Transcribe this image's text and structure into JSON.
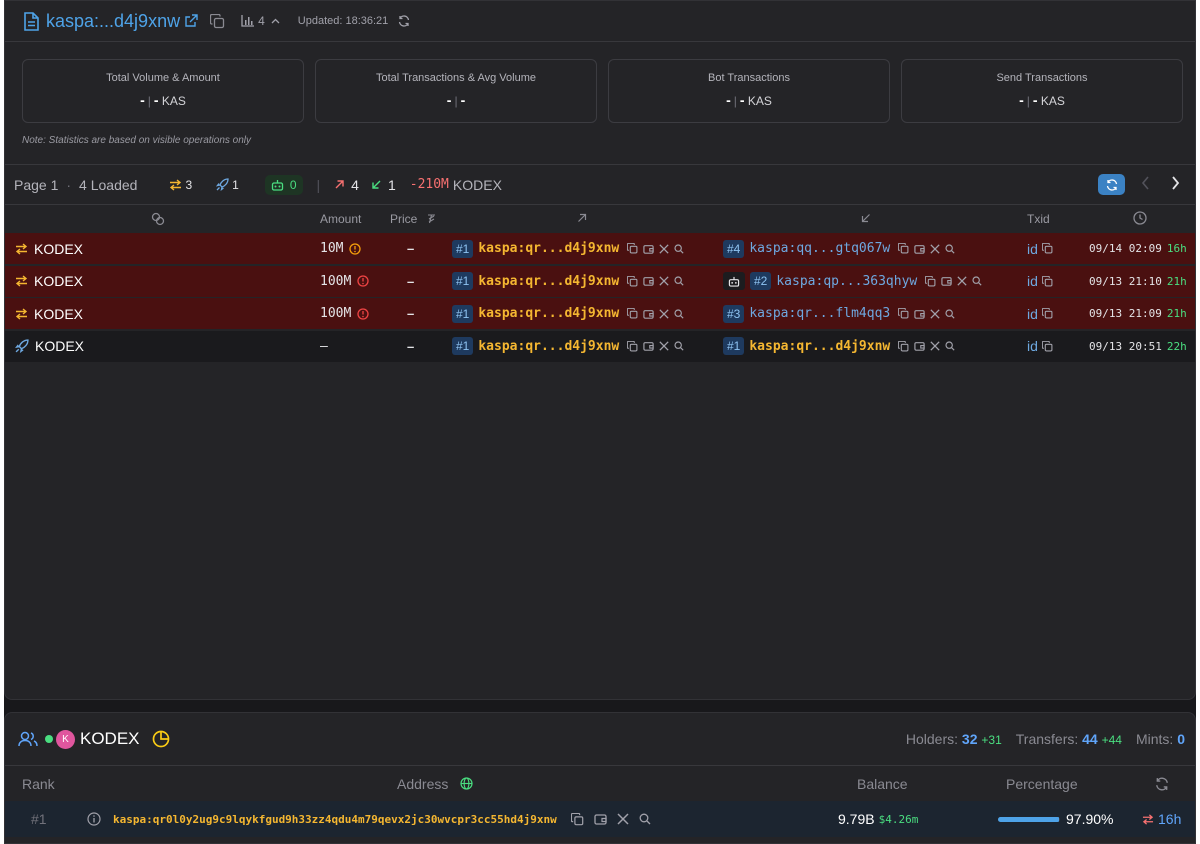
{
  "header": {
    "title": "kaspa:...d4j9xnw",
    "holders_count": "4",
    "updated": "Updated: 18:36:21"
  },
  "cards": [
    {
      "title": "Total Volume & Amount",
      "v1": "-",
      "sep": "|",
      "v2": "-",
      "unit": "KAS"
    },
    {
      "title": "Total Transactions & Avg Volume",
      "v1": "-",
      "sep": "|",
      "v2": "-",
      "unit": ""
    },
    {
      "title": "Bot Transactions",
      "v1": "-",
      "sep": "|",
      "v2": "-",
      "unit": "KAS"
    },
    {
      "title": "Send Transactions",
      "v1": "-",
      "sep": "|",
      "v2": "-",
      "unit": "KAS"
    }
  ],
  "note": "Note: Statistics are based on visible operations only",
  "toolbar": {
    "page": "Page 1",
    "dot": "·",
    "loaded": "4 Loaded",
    "transfers": "3",
    "mints": "1",
    "bots": "0",
    "divider": "|",
    "out": "4",
    "in": "1",
    "delta": "-210M",
    "unit": "KODEX"
  },
  "table": {
    "headers": {
      "amount": "Amount",
      "price": "Price"
    },
    "txid_header": "Txid",
    "rows": [
      {
        "type": "transfer",
        "token": "KODEX",
        "amount": "10M",
        "warn_color": "#f59e0b",
        "price": "–",
        "from_badge": "#1",
        "from": "kaspa:qr...d4j9xnw",
        "to_badge": "#4",
        "to": "kaspa:qq...gtq067w",
        "to_bot": false,
        "txid": "id",
        "date": "09/14 02:09",
        "ago": "16h",
        "style": "red",
        "from_gold": true,
        "to_gold": false
      },
      {
        "type": "transfer",
        "token": "KODEX",
        "amount": "100M",
        "warn_color": "#ef4444",
        "price": "–",
        "from_badge": "#1",
        "from": "kaspa:qr...d4j9xnw",
        "to_badge": "#2",
        "to": "kaspa:qp...363qhyw",
        "to_bot": true,
        "txid": "id",
        "date": "09/13 21:10",
        "ago": "21h",
        "style": "red",
        "from_gold": true,
        "to_gold": false
      },
      {
        "type": "transfer",
        "token": "KODEX",
        "amount": "100M",
        "warn_color": "#ef4444",
        "price": "–",
        "from_badge": "#1",
        "from": "kaspa:qr...d4j9xnw",
        "to_badge": "#3",
        "to": "kaspa:qr...flm4qq3",
        "to_bot": false,
        "txid": "id",
        "date": "09/13 21:09",
        "ago": "21h",
        "style": "red",
        "from_gold": true,
        "to_gold": false
      },
      {
        "type": "mint",
        "token": "KODEX",
        "amount": "–",
        "warn_color": "",
        "price": "–",
        "from_badge": "#1",
        "from": "kaspa:qr...d4j9xnw",
        "to_badge": "#1",
        "to": "kaspa:qr...d4j9xnw",
        "to_bot": false,
        "txid": "id",
        "date": "09/13 20:51",
        "ago": "22h",
        "style": "dark",
        "from_gold": true,
        "to_gold": true
      }
    ]
  },
  "holders_panel": {
    "avatar": "K",
    "token": "KODEX",
    "holders_label": "Holders:",
    "holders": "32",
    "holders_plus": "+31",
    "transfers_label": "Transfers:",
    "transfers": "44",
    "transfers_plus": "+44",
    "mints_label": "Mints:",
    "mints": "0",
    "headers": {
      "rank": "Rank",
      "address": "Address",
      "balance": "Balance",
      "percentage": "Percentage"
    },
    "row": {
      "rank": "#1",
      "address": "kaspa:qr0l0y2ug9c9lqykfgud9h33zz4qdu4m79qevx2jc30wvcpr3cc55hd4j9xnw",
      "balance": "9.79B",
      "usd": "$4.26m",
      "percentage": "97.90%",
      "percentage_value": 97.9,
      "ago": "16h"
    }
  },
  "colors": {
    "accent": "#4ea3e8",
    "gold": "#f5b731",
    "up": "#f87171",
    "down": "#4ade80",
    "row_red": "#4a1010"
  }
}
